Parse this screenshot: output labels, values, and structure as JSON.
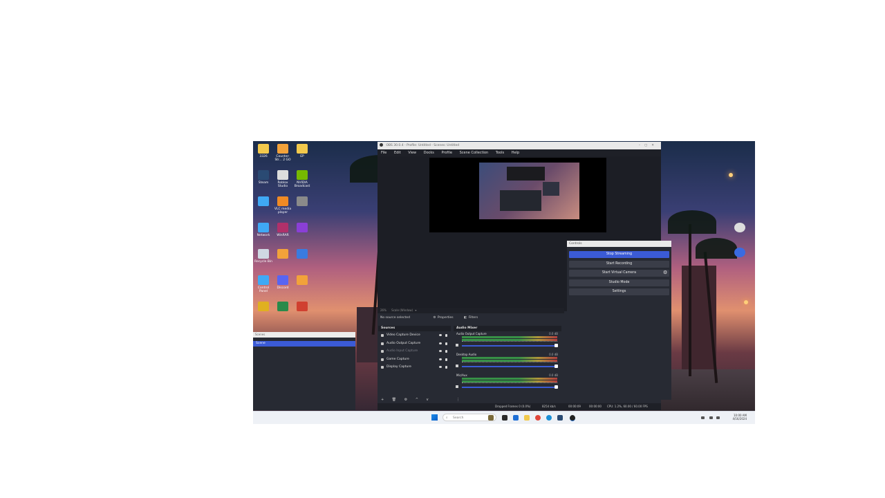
{
  "desktop": {
    "icons": [
      {
        "label": "3326",
        "color": "#f2c94c"
      },
      {
        "label": "Counter-Str... 2 GO",
        "color": "#f2a23a"
      },
      {
        "label": "EP",
        "color": "#f2c94c"
      },
      {
        "label": "Steam",
        "color": "#2a4a73"
      },
      {
        "label": "Roblox Studio",
        "color": "#dddddd"
      },
      {
        "label": "NVIDIA Broadcast",
        "color": "#76b900"
      },
      {
        "label": "",
        "color": "#3fa9f5"
      },
      {
        "label": "VLC media player",
        "color": "#f08a24"
      },
      {
        "label": "",
        "color": "#8a8a8a"
      },
      {
        "label": "Network",
        "color": "#3fa9f5"
      },
      {
        "label": "WinRAR",
        "color": "#b0306a"
      },
      {
        "label": "",
        "color": "#8a3fd6"
      },
      {
        "label": "Recycle Bin",
        "color": "#cfd8e3"
      },
      {
        "label": "",
        "color": "#f2a23a"
      },
      {
        "label": "",
        "color": "#3a7be0"
      },
      {
        "label": "Control Panel",
        "color": "#3fa9f5"
      },
      {
        "label": "Discord",
        "color": "#5865f2"
      },
      {
        "label": "",
        "color": "#f2a23a"
      },
      {
        "label": "",
        "color": "#e0b020"
      },
      {
        "label": "",
        "color": "#2a8a4a"
      },
      {
        "label": "",
        "color": "#d04030"
      }
    ],
    "right_icons": [
      {
        "label": "",
        "color": "#dddddd"
      },
      {
        "label": "",
        "color": "#3a6be0"
      }
    ]
  },
  "obs": {
    "title": "OBS 30.0.4 - Profile: Untitled - Scenes: Untitled",
    "menu": [
      "File",
      "Edit",
      "View",
      "Docks",
      "Profile",
      "Scene Collection",
      "Tools",
      "Help"
    ],
    "zoom": "26%",
    "scale": "Scale (Window)",
    "no_source": "No source selected",
    "properties": "Properties",
    "filters": "Filters",
    "sources_title": "Sources",
    "sources": [
      {
        "name": "Video Capture Device",
        "dim": false
      },
      {
        "name": "Audio Output Capture",
        "dim": false
      },
      {
        "name": "Audio Input Capture",
        "dim": true
      },
      {
        "name": "Game Capture",
        "dim": false
      },
      {
        "name": "Display Capture",
        "dim": false
      }
    ],
    "mixer_title": "Audio Mixer",
    "channels": [
      {
        "name": "Audio Output Capture",
        "db": "0.0 dB"
      },
      {
        "name": "Desktop Audio",
        "db": "0.0 dB"
      },
      {
        "name": "Mic/Aux",
        "db": "0.0 dB"
      }
    ],
    "status": {
      "dropped": "Dropped Frames 0 (0.0%)",
      "bitrate": "8254 kb/s",
      "stream_time": "00:00:09",
      "rec_time": "00:00:00",
      "cpu": "CPU: 1.2%, 60.00 / 60.00 FPS"
    }
  },
  "controls": {
    "title": "Controls",
    "buttons": [
      {
        "label": "Stop Streaming",
        "active": true
      },
      {
        "label": "Start Recording",
        "active": false
      },
      {
        "label": "Start Virtual Camera",
        "active": false
      },
      {
        "label": "Studio Mode",
        "active": false
      },
      {
        "label": "Settings",
        "active": false
      }
    ]
  },
  "scenes": {
    "title": "Scenes",
    "item": "Scene"
  },
  "taskbar": {
    "search_placeholder": "Search",
    "time": "10:00 AM",
    "date": "4/16/2024"
  }
}
